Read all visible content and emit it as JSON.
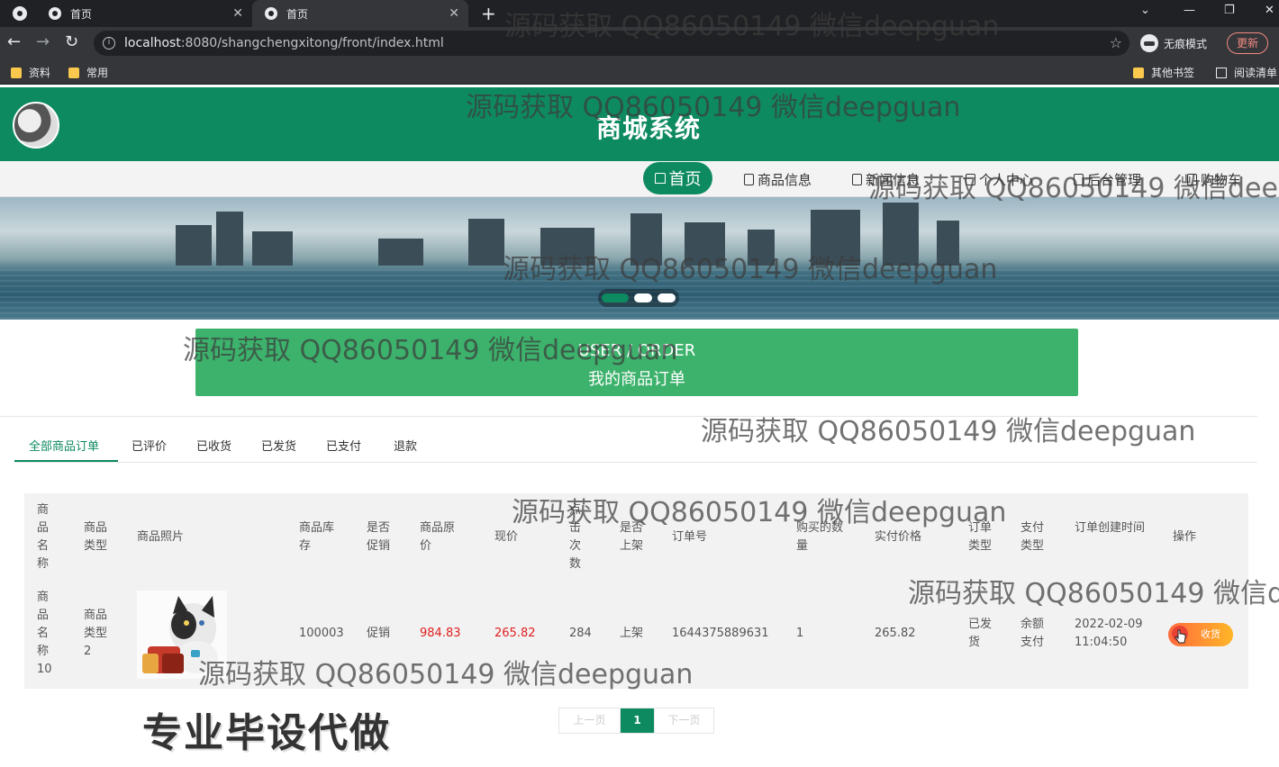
{
  "browser": {
    "tabs": [
      {
        "title": "首页",
        "active": false
      },
      {
        "title": "首页",
        "active": true
      }
    ],
    "url_host": "localhost",
    "url_path": ":8080/shangchengxitong/front/index.html",
    "incognito_label": "无痕模式",
    "update_label": "更新",
    "bookmarks": [
      "资料",
      "常用"
    ],
    "other_bookmarks": "其他书签",
    "reading_list": "阅读清单"
  },
  "site": {
    "title": "商城系统",
    "brand_color": "#0e8a61",
    "nav": [
      "首页",
      "商品信息",
      "新闻信息",
      "个人中心",
      "后台管理",
      "购物车"
    ]
  },
  "section": {
    "title_en": "USER / ORDER",
    "title_cn": "我的商品订单"
  },
  "order_tabs": [
    "全部商品订单",
    "已评价",
    "已收货",
    "已发货",
    "已支付",
    "退款"
  ],
  "table": {
    "headers": [
      "商品名称",
      "商品类型",
      "商品照片",
      "商品库存",
      "是否促销",
      "商品原价",
      "现价",
      "点击次数",
      "是否上架",
      "订单号",
      "购买的数量",
      "实付价格",
      "订单类型",
      "支付类型",
      "订单创建时间",
      "操作"
    ],
    "rows": [
      {
        "name": "商品名称10",
        "type": "商品类型2",
        "stock": "100003",
        "promo": "促销",
        "original_price": "984.83",
        "price": "265.82",
        "clicks": "284",
        "on_shelf": "上架",
        "order_no": "1644375889631",
        "quantity": "1",
        "paid": "265.82",
        "order_type": "已发货",
        "pay_type": "余额支付",
        "created": "2022-02-09 11:04:50",
        "action": "收货"
      }
    ]
  },
  "pager": {
    "prev": "上一页",
    "current": "1",
    "next": "下一页"
  },
  "overlays": {
    "watermark": "源码获取 QQ86050149 微信deepguan",
    "ad": "专业毕设代做"
  }
}
